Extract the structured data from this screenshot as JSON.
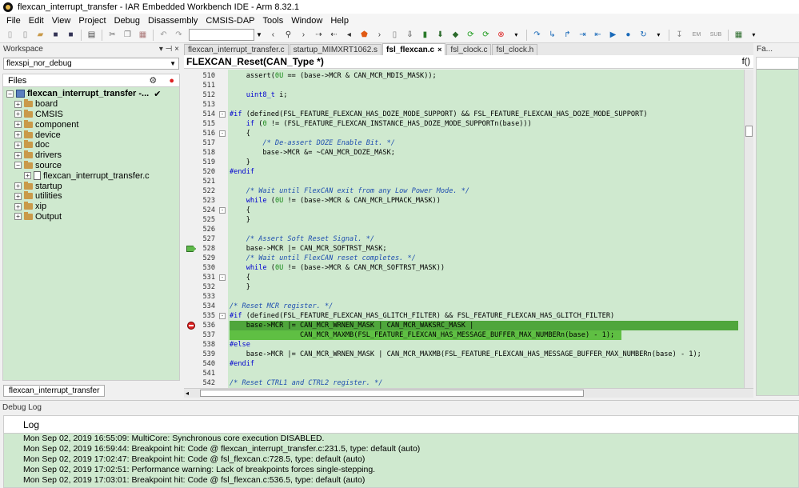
{
  "window": {
    "title": "flexcan_interrupt_transfer - IAR Embedded Workbench IDE - Arm 8.32.1"
  },
  "menu": [
    "File",
    "Edit",
    "View",
    "Project",
    "Debug",
    "Disassembly",
    "CMSIS-DAP",
    "Tools",
    "Window",
    "Help"
  ],
  "toolbar": {
    "emu_label": "EM",
    "sub_label": "SUB"
  },
  "workspace": {
    "title": "Workspace",
    "config": "flexspi_nor_debug",
    "files_header": "Files",
    "tree": [
      {
        "label": "flexcan_interrupt_transfer -...",
        "level": 0,
        "type": "project",
        "bold": true,
        "check": "✔"
      },
      {
        "label": "board",
        "level": 1,
        "type": "folder"
      },
      {
        "label": "CMSIS",
        "level": 1,
        "type": "folder"
      },
      {
        "label": "component",
        "level": 1,
        "type": "folder"
      },
      {
        "label": "device",
        "level": 1,
        "type": "folder"
      },
      {
        "label": "doc",
        "level": 1,
        "type": "folder"
      },
      {
        "label": "drivers",
        "level": 1,
        "type": "folder"
      },
      {
        "label": "source",
        "level": 1,
        "type": "folder",
        "expanded": true
      },
      {
        "label": "flexcan_interrupt_transfer.c",
        "level": 2,
        "type": "file"
      },
      {
        "label": "startup",
        "level": 1,
        "type": "folder"
      },
      {
        "label": "utilities",
        "level": 1,
        "type": "folder"
      },
      {
        "label": "xip",
        "level": 1,
        "type": "folder"
      },
      {
        "label": "Output",
        "level": 1,
        "type": "folder"
      }
    ],
    "bottom_tab": "flexcan_interrupt_transfer"
  },
  "editor": {
    "tabs": [
      {
        "label": "flexcan_interrupt_transfer.c",
        "active": false
      },
      {
        "label": "startup_MIMXRT1062.s",
        "active": false
      },
      {
        "label": "fsl_flexcan.c",
        "active": true
      },
      {
        "label": "fsl_clock.c",
        "active": false
      },
      {
        "label": "fsl_clock.h",
        "active": false
      }
    ],
    "function": "FLEXCAN_Reset(CAN_Type *)",
    "fx_label": "f()",
    "lines": [
      {
        "n": "510",
        "text": "    assert(0U == (base->MCR & CAN_MCR_MDIS_MASK));"
      },
      {
        "n": "511",
        "text": ""
      },
      {
        "n": "512",
        "text": "    uint8_t i;"
      },
      {
        "n": "513",
        "text": ""
      },
      {
        "n": "514",
        "text": "#if (defined(FSL_FEATURE_FLEXCAN_HAS_DOZE_MODE_SUPPORT) && FSL_FEATURE_FLEXCAN_HAS_DOZE_MODE_SUPPORT)",
        "fold": "-"
      },
      {
        "n": "515",
        "text": "    if (0 != (FSL_FEATURE_FLEXCAN_INSTANCE_HAS_DOZE_MODE_SUPPORTn(base)))"
      },
      {
        "n": "516",
        "text": "    {",
        "fold": "-"
      },
      {
        "n": "517",
        "text": "        /* De-assert DOZE Enable Bit. */"
      },
      {
        "n": "518",
        "text": "        base->MCR &= ~CAN_MCR_DOZE_MASK;"
      },
      {
        "n": "519",
        "text": "    }"
      },
      {
        "n": "520",
        "text": "#endif"
      },
      {
        "n": "521",
        "text": ""
      },
      {
        "n": "522",
        "text": "    /* Wait until FlexCAN exit from any Low Power Mode. */"
      },
      {
        "n": "523",
        "text": "    while (0U != (base->MCR & CAN_MCR_LPMACK_MASK))"
      },
      {
        "n": "524",
        "text": "    {",
        "fold": "-"
      },
      {
        "n": "525",
        "text": "    }"
      },
      {
        "n": "526",
        "text": ""
      },
      {
        "n": "527",
        "text": "    /* Assert Soft Reset Signal. */"
      },
      {
        "n": "528",
        "text": "    base->MCR |= CAN_MCR_SOFTRST_MASK;",
        "marker": "pc"
      },
      {
        "n": "529",
        "text": "    /* Wait until FlexCAN reset completes. */"
      },
      {
        "n": "530",
        "text": "    while (0U != (base->MCR & CAN_MCR_SOFTRST_MASK))"
      },
      {
        "n": "531",
        "text": "    {",
        "fold": "-"
      },
      {
        "n": "532",
        "text": "    }"
      },
      {
        "n": "533",
        "text": ""
      },
      {
        "n": "534",
        "text": "/* Reset MCR register. */"
      },
      {
        "n": "535",
        "text": "#if (defined(FSL_FEATURE_FLEXCAN_HAS_GLITCH_FILTER) && FSL_FEATURE_FLEXCAN_HAS_GLITCH_FILTER)",
        "fold": "-"
      },
      {
        "n": "536",
        "text": "    base->MCR |= CAN_MCR_WRNEN_MASK | CAN_MCR_WAKSRC_MASK |",
        "marker": "bp",
        "highlight": "current"
      },
      {
        "n": "537",
        "text": "                 CAN_MCR_MAXMB(FSL_FEATURE_FLEXCAN_HAS_MESSAGE_BUFFER_MAX_NUMBERn(base) - 1);",
        "highlight": "stmt"
      },
      {
        "n": "538",
        "text": "#else"
      },
      {
        "n": "539",
        "text": "    base->MCR |= CAN_MCR_WRNEN_MASK | CAN_MCR_MAXMB(FSL_FEATURE_FLEXCAN_HAS_MESSAGE_BUFFER_MAX_NUMBERn(base) - 1);"
      },
      {
        "n": "540",
        "text": "#endif"
      },
      {
        "n": "541",
        "text": ""
      },
      {
        "n": "542",
        "text": "/* Reset CTRL1 and CTRL2 register. */"
      }
    ]
  },
  "right_panel": {
    "title": "Fa..."
  },
  "debug_log": {
    "title": "Debug Log",
    "column": "Log",
    "entries": [
      "Mon Sep 02, 2019 16:55:09: MultiCore: Synchronous core execution DISABLED.",
      "Mon Sep 02, 2019 16:59:44: Breakpoint hit: Code @ flexcan_interrupt_transfer.c:231.5, type: default (auto)",
      "Mon Sep 02, 2019 17:02:47: Breakpoint hit: Code @ fsl_flexcan.c:728.5, type: default (auto)",
      "Mon Sep 02, 2019 17:02:51: Performance warning: Lack of breakpoints forces single-stepping.",
      "Mon Sep 02, 2019 17:03:01: Breakpoint hit: Code @ fsl_flexcan.c:536.5, type: default (auto)"
    ]
  }
}
